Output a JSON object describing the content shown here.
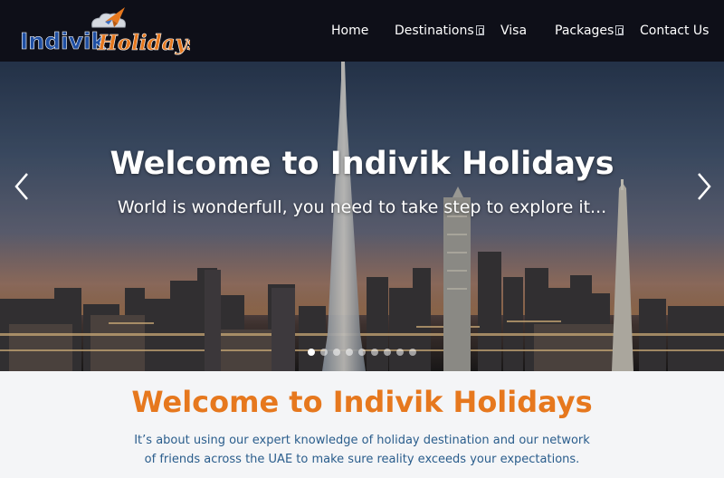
{
  "brand": {
    "name_part1": "Indivik",
    "name_part2": "Holidays",
    "colors": {
      "part1": "#1f4fa3",
      "part2": "#e6781e"
    }
  },
  "nav": {
    "items": [
      {
        "label": "Home",
        "has_dropdown": false
      },
      {
        "label": "Destinations",
        "has_dropdown": true
      },
      {
        "label": "Visa",
        "has_dropdown": false
      },
      {
        "label": "Packages",
        "has_dropdown": true
      },
      {
        "label": "Contact Us",
        "has_dropdown": false
      }
    ]
  },
  "hero": {
    "title": "Welcome to Indivik Holidays",
    "subtitle": "World is wonderfull, you need to take step to explore it...",
    "prev_icon": "chevron-left-icon",
    "next_icon": "chevron-right-icon",
    "slide_count": 9,
    "active_slide": 1
  },
  "welcome": {
    "title": "Welcome to Indivik Holidays",
    "text": "It’s about using our expert knowledge of holiday destination and our network of friends across the UAE to make sure reality exceeds your expectations.",
    "colors": {
      "title": "#e6781e",
      "text": "#2a5d8c"
    }
  }
}
